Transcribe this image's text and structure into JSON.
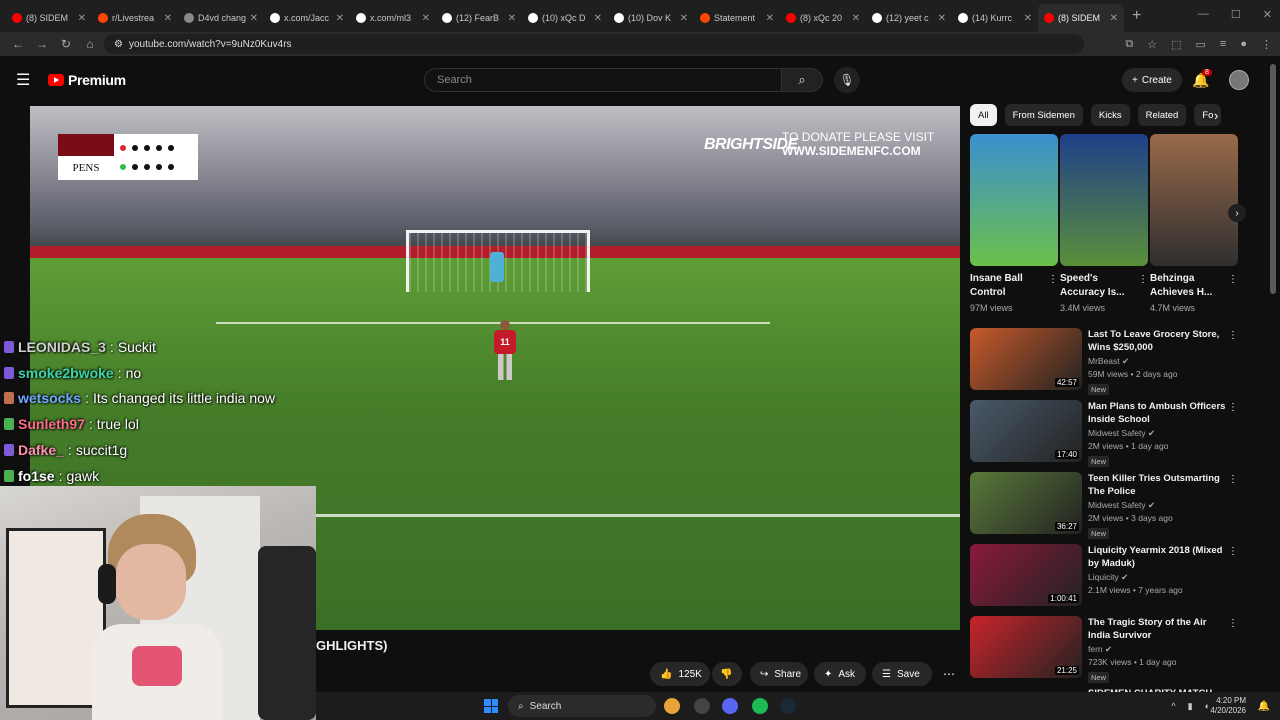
{
  "browser": {
    "tabs": [
      {
        "title": "(8) SIDEM",
        "color": "#ff0000"
      },
      {
        "title": "r/Livestrea",
        "color": "#ff4500"
      },
      {
        "title": "D4vd chang",
        "color": "#888888"
      },
      {
        "title": "x.com/Jacc",
        "color": "#ffffff"
      },
      {
        "title": "x.com/ml3",
        "color": "#ffffff"
      },
      {
        "title": "(12) FearB",
        "color": "#ffffff"
      },
      {
        "title": "(10) xQc D",
        "color": "#ffffff"
      },
      {
        "title": "(10) Dov K",
        "color": "#ffffff"
      },
      {
        "title": "Statement",
        "color": "#ff4500"
      },
      {
        "title": "(8) xQc 20",
        "color": "#ff0000"
      },
      {
        "title": "(12) yeet c",
        "color": "#ffffff"
      },
      {
        "title": "(14) Kurrc",
        "color": "#ffffff"
      },
      {
        "title": "(8) SIDEM",
        "color": "#ff0000"
      }
    ],
    "active_tab": 12,
    "new_tab": "+",
    "url": "youtube.com/watch?v=9uNz0Kuv4rs"
  },
  "youtube": {
    "logo_text": "Premium",
    "search_placeholder": "Search",
    "create_label": "Create",
    "notification_count": "8",
    "video_title_fragment": "GHLIGHTS)",
    "actions": {
      "likes": "125K",
      "share": "Share",
      "ask": "Ask",
      "save": "Save"
    },
    "chips": [
      "All",
      "From Sidemen",
      "Kicks",
      "Related",
      "Fo"
    ],
    "shorts": [
      {
        "title": "Insane Ball Control",
        "views": "97M views",
        "colors": [
          "#3a8fd0",
          "#6cc04a"
        ]
      },
      {
        "title": "Speed's Accuracy Is...",
        "views": "3.4M views",
        "colors": [
          "#1f3f8a",
          "#5a8f3a"
        ]
      },
      {
        "title": "Behzinga Achieves H...",
        "views": "4.7M views",
        "colors": [
          "#9a6a4a",
          "#2f2f2f"
        ]
      }
    ],
    "recommendations": [
      {
        "title": "Last To Leave Grocery Store, Wins $250,000",
        "channel": "MrBeast",
        "meta": "59M views • 2 days ago",
        "badge": "New",
        "duration": "42:57",
        "color": "#c75a2a"
      },
      {
        "title": "Man Plans to Ambush Officers Inside School",
        "channel": "Midwest Safety",
        "meta": "2M views • 1 day ago",
        "badge": "New",
        "duration": "17:40",
        "color": "#4a5a6a"
      },
      {
        "title": "Teen Killer Tries Outsmarting The Police",
        "channel": "Midwest Safety",
        "meta": "2M views • 3 days ago",
        "badge": "New",
        "duration": "36:27",
        "color": "#5a7a3a"
      },
      {
        "title": "Liquicity Yearmix 2018 (Mixed by Maduk)",
        "channel": "Liquicity",
        "meta": "2.1M views • 7 years ago",
        "badge": "",
        "duration": "1:00:41",
        "color": "#8a1a3a"
      },
      {
        "title": "The Tragic Story of the Air India Survivor",
        "channel": "fern",
        "meta": "723K views • 1 day ago",
        "badge": "New",
        "duration": "21:25",
        "color": "#c8242a"
      }
    ],
    "next_rec_partial": "SIDEMEN CHARITY MATCH"
  },
  "stream_overlay": {
    "scoreboard_label": "PENS",
    "sponsor": "BRIGHTSIDE",
    "donate_line1": "TO DONATE PLEASE VISIT",
    "donate_line2": "WWW.SIDEMENFC.COM",
    "player_number": "11",
    "chat": [
      {
        "user": "LEONIDAS_3",
        "message": "Suckit",
        "user_color": "#d0d0d0",
        "badge": "#7b5cd6"
      },
      {
        "user": "smoke2bwoke",
        "message": "no",
        "user_color": "#3fd3a8",
        "badge": "#7b5cd6"
      },
      {
        "user": "wetsocks",
        "message": "Its changed its little india now",
        "user_color": "#6fa8ff",
        "badge": "#c07050"
      },
      {
        "user": "Sunleth97",
        "message": "true lol",
        "user_color": "#ff6b8b",
        "badge": "#4caf50"
      },
      {
        "user": "Dafke_",
        "message": "succit1g",
        "user_color": "#ff8fb0",
        "badge": "#7b5cd6"
      },
      {
        "user": "fo1se",
        "message": "gawk",
        "user_color": "#ffffff",
        "badge": "#4caf50"
      }
    ]
  },
  "taskbar": {
    "search_label": "Search",
    "time": "4:20 PM",
    "date": "4/20/2026"
  }
}
